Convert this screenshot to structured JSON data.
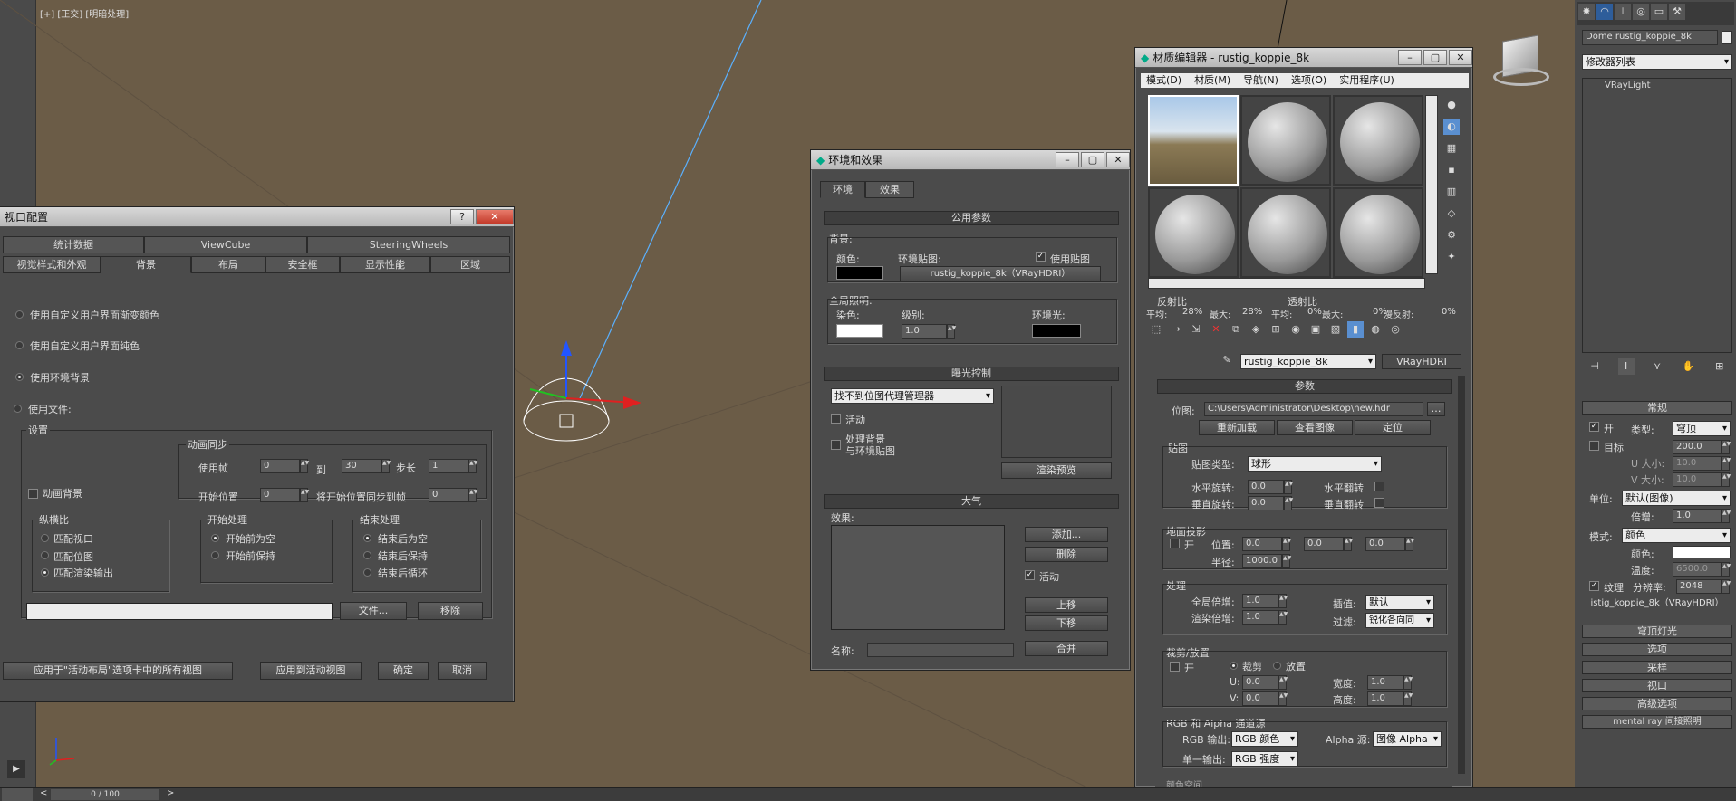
{
  "viewport": {
    "label": "[+] [正交] [明暗处理]",
    "frame": "0 / 100"
  },
  "vpconfig": {
    "title": "视口配置",
    "tabs_row1": [
      "统计数据",
      "ViewCube",
      "SteeringWheels"
    ],
    "tabs_row2": [
      "视觉样式和外观",
      "背景",
      "布局",
      "安全框",
      "显示性能",
      "区域"
    ],
    "options": [
      "使用自定义用户界面渐变颜色",
      "使用自定义用户界面纯色",
      "使用环境背景",
      "使用文件:"
    ],
    "settings": "设置",
    "anim_bg": "动画背景",
    "anim_sync": "动画同步",
    "use_frame": "使用帧",
    "frame_from": "0",
    "to": "到",
    "frame_to": "30",
    "step": "步长",
    "step_val": "1",
    "start_pos": "开始位置",
    "start_val": "0",
    "sync_label": "将开始位置同步到帧",
    "sync_val": "0",
    "aspect": "纵横比",
    "aspect_opts": [
      "匹配视口",
      "匹配位图",
      "匹配渲染输出"
    ],
    "start_proc": "开始处理",
    "start_opts": [
      "开始前为空",
      "开始前保持"
    ],
    "end_proc": "结束处理",
    "end_opts": [
      "结束后为空",
      "结束后保持",
      "结束后循环"
    ],
    "file_btn": "文件...",
    "remove_btn": "移除",
    "apply_all": "应用于\"活动布局\"选项卡中的所有视图",
    "apply_active": "应用到活动视图",
    "ok": "确定",
    "cancel": "取消"
  },
  "env": {
    "title": "环境和效果",
    "tabs": [
      "环境",
      "效果"
    ],
    "common": "公用参数",
    "bg": "背景:",
    "color": "颜色:",
    "envmap": "环境贴图:",
    "usemap": "使用贴图",
    "mapname": "rustig_koppie_8k（VRayHDRI）",
    "global": "全局照明:",
    "tint": "染色:",
    "level": "级别:",
    "level_val": "1.0",
    "ambient": "环境光:",
    "exposure": "曝光控制",
    "exp_sel": "找不到位图代理管理器",
    "active": "活动",
    "process_bg": "处理背景",
    "with_env": "与环境贴图",
    "render_preview": "渲染预览",
    "atmos": "大气",
    "effects": "效果:",
    "add": "添加...",
    "delete": "删除",
    "active2": "活动",
    "up": "上移",
    "down": "下移",
    "name": "名称:",
    "merge": "合并"
  },
  "mat": {
    "title": "材质编辑器 - rustig_koppie_8k",
    "menu": [
      "模式(D)",
      "材质(M)",
      "导航(N)",
      "选项(O)",
      "实用程序(U)"
    ],
    "reflect": "反射比",
    "avg1": "平均:",
    "avg1v": "28%",
    "max1": "最大:",
    "max1v": "28%",
    "trans": "透射比",
    "avg2": "平均:",
    "avg2v": "0%",
    "max2": "最大:",
    "max2v": "0%",
    "diff": "漫反射:",
    "diffv": "0%",
    "mapname": "rustig_koppie_8k",
    "maptype": "VRayHDRI",
    "params": "参数",
    "bitmap": "位图:",
    "path": "C:\\Users\\Administrator\\Desktop\\new.hdr",
    "reload": "重新加载",
    "view": "查看图像",
    "locate": "定位",
    "map": "贴图",
    "maptype_lbl": "贴图类型:",
    "maptype_val": "球形",
    "hrot": "水平旋转:",
    "hrot_v": "0.0",
    "hflip": "水平翻转",
    "vrot": "垂直旋转:",
    "vrot_v": "0.0",
    "vflip": "垂直翻转",
    "ground": "地面投影",
    "on": "开",
    "pos": "位置:",
    "pos_vals": [
      "0.0",
      "0.0",
      "0.0"
    ],
    "radius": "半径:",
    "radius_v": "1000.0",
    "proc": "处理",
    "gmult": "全局倍增:",
    "gmult_v": "1.0",
    "interp": "插值:",
    "interp_v": "默认",
    "rmult": "渲染倍增:",
    "rmult_v": "1.0",
    "filter": "过滤:",
    "filter_v": "锐化各向同",
    "crop": "裁剪/放置",
    "on2": "开",
    "crop_opt": "裁剪",
    "place_opt": "放置",
    "u": "U:",
    "u_v": "0.0",
    "w": "宽度:",
    "w_v": "1.0",
    "v": "V:",
    "v_v": "0.0",
    "h": "高度:",
    "h_v": "1.0",
    "rgb": "RGB 和 Alpha 通道源",
    "rgbout": "RGB 输出:",
    "rgbout_v": "RGB 颜色",
    "alphasrc": "Alpha 源:",
    "alphasrc_v": "图像 Alpha",
    "monoout": "单一输出:",
    "monoout_v": "RGB 强度",
    "more": "颜色空间"
  },
  "cmd": {
    "objname": "Dome rustig_koppie_8k",
    "modlist": "修改器列表",
    "stack_item": "VRayLight",
    "general": "常规",
    "on": "开",
    "type": "类型:",
    "type_v": "穹顶",
    "target": "目标",
    "target_v": "200.0",
    "usize": "U 大小:",
    "usize_v": "10.0",
    "vsize": "V 大小:",
    "vsize_v": "10.0",
    "units": "单位:",
    "units_v": "默认(图像)",
    "mult": "倍增:",
    "mult_v": "1.0",
    "mode": "模式:",
    "mode_v": "颜色",
    "color": "颜色:",
    "temp": "温度:",
    "temp_v": "6500.0",
    "texture": "纹理",
    "res": "分辨率:",
    "res_v": "2048",
    "texname": "istig_koppie_8k（VRayHDRI）",
    "rollouts": [
      "穹顶灯光",
      "选项",
      "采样",
      "视口",
      "高级选项",
      "mental ray 间接照明"
    ]
  },
  "colors": {
    "viewport_bg": "#6b5c47",
    "panel": "#4b4b4b",
    "accent": "#5ab0ff"
  }
}
